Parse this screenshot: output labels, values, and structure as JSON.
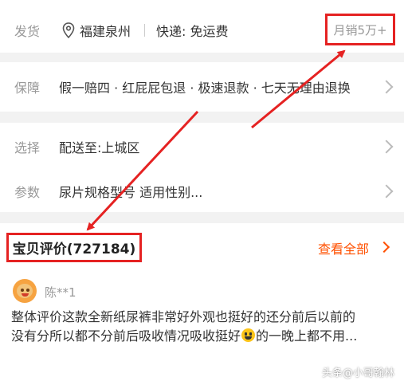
{
  "shipping": {
    "label": "发货",
    "location": "福建泉州",
    "fee": "快递: 免运费",
    "sales": "月销5万+"
  },
  "guarantee": {
    "label": "保障",
    "value": "假一赔四 · 红屁屁包退 · 极速退款 · 七天无理由退换"
  },
  "select": {
    "label": "选择",
    "value": "配送至:上城区"
  },
  "params": {
    "label": "参数",
    "value": "尿片规格型号 适用性别..."
  },
  "reviews": {
    "title": "宝贝评价(727184)",
    "see_all": "查看全部",
    "user": "陈**1",
    "text_line1": "整体评价这款全新纸尿裤非常好外观也挺好的还分前后以前的",
    "text_line2a": "没有分所以都不分前后吸收情况吸收挺好",
    "text_line2b": "的一晚上都不用..."
  },
  "watermark": "头条@小哥翰林",
  "colors": {
    "accent": "#ff5000",
    "highlight_box": "#e52222"
  },
  "icons": {
    "location": "location-pin-icon",
    "chevron": "chevron-right-icon",
    "emoji": "grinning-face-icon"
  }
}
